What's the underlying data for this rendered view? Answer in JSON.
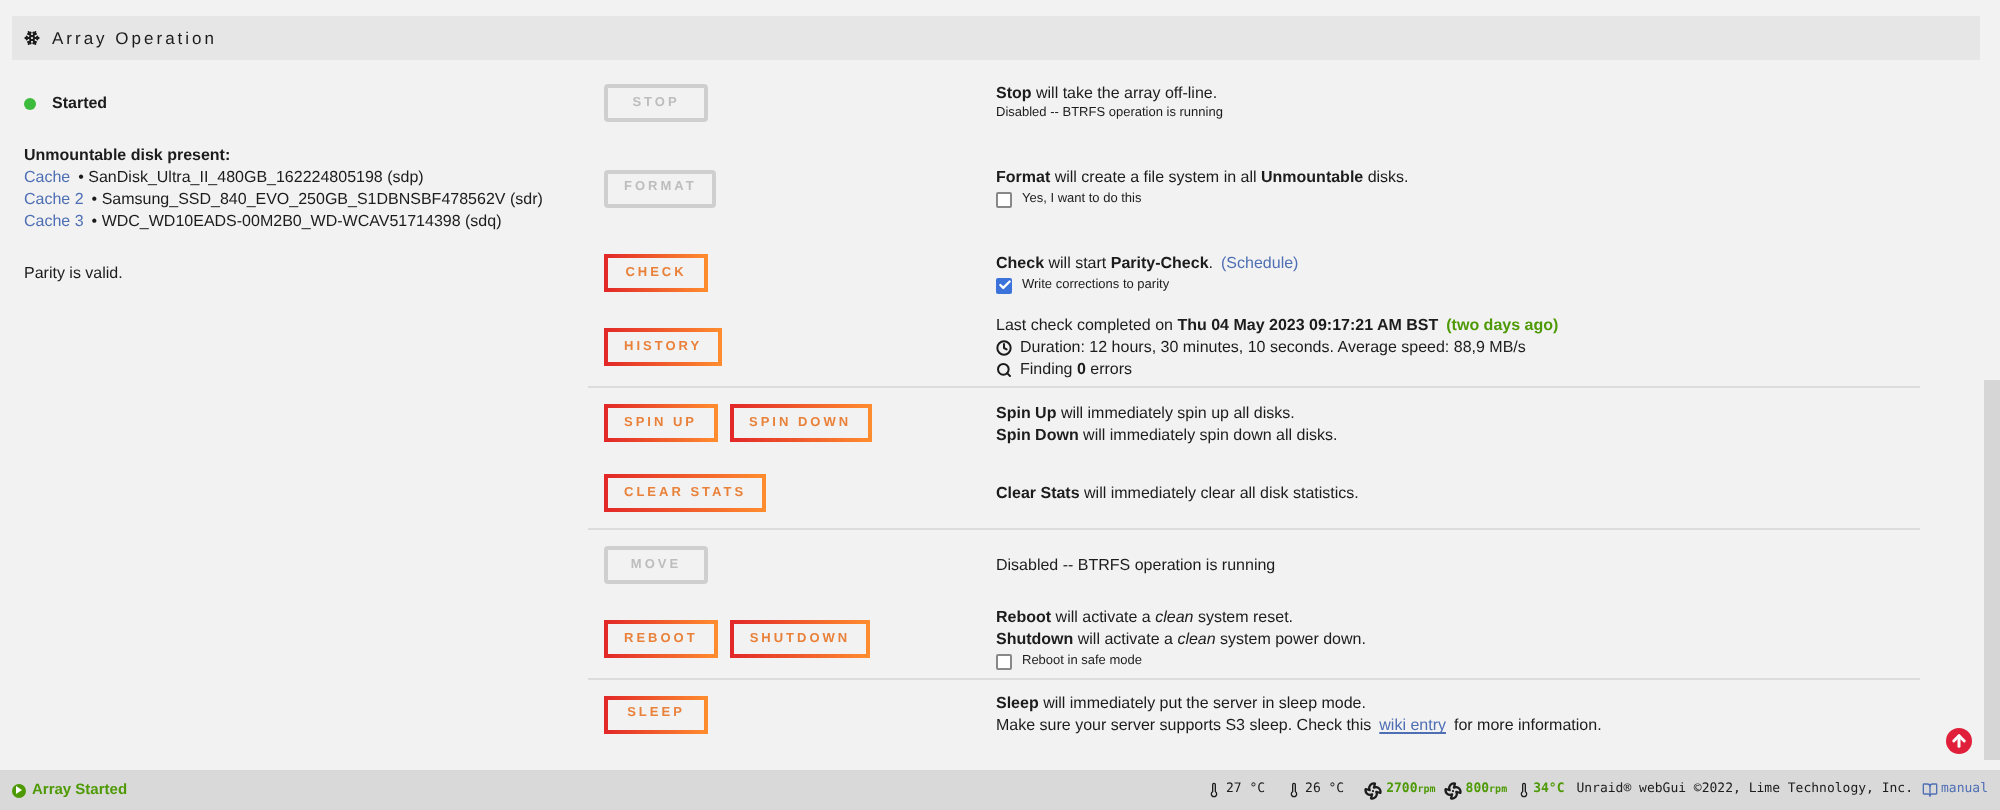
{
  "panel": {
    "title": "Array Operation"
  },
  "sections": [
    {
      "rows": [
        {
          "left": {
            "kind": "status",
            "label": "Started"
          },
          "buttons": [
            {
              "label": "STOP",
              "disabled": true
            }
          ],
          "lines": [
            {
              "kind": "text",
              "text": "**Stop** will take the array off-line."
            },
            {
              "kind": "note",
              "text": "Disabled -- BTRFS operation is running"
            }
          ]
        },
        {
          "left": {
            "kind": "disks",
            "heading": "Unmountable disk present:",
            "disks": [
              {
                "link": "Cache",
                "text": "• SanDisk_Ultra_II_480GB_162224805198 (sdp)"
              },
              {
                "link": "Cache 2",
                "text": "• Samsung_SSD_840_EVO_250GB_S1DBNSBF478562V (sdr)"
              },
              {
                "link": "Cache 3",
                "text": "• WDC_WD10EADS-00M2B0_WD-WCAV51714398 (sdq)"
              }
            ]
          },
          "buttons": [
            {
              "label": "FORMAT",
              "disabled": true
            }
          ],
          "lines": [
            {
              "kind": "text",
              "text": "**Format** will create a file system in all **Unmountable** disks."
            },
            {
              "kind": "checkbox",
              "text": "Yes, I want to do this",
              "checked": false
            }
          ]
        },
        {
          "left": {
            "kind": "text",
            "label": "Parity is valid."
          },
          "buttons": [
            {
              "label": "CHECK",
              "disabled": false
            }
          ],
          "lines": [
            {
              "kind": "text",
              "text": "**Check** will start **Parity-Check**.",
              "link": "(Schedule)"
            },
            {
              "kind": "checkbox",
              "text": "Write corrections to parity",
              "checked": true
            }
          ]
        },
        {
          "buttons": [
            {
              "label": "HISTORY",
              "disabled": false
            }
          ],
          "lines": [
            {
              "kind": "text",
              "text": "Last check completed on **Thu 04 May 2023 09:17:21 AM BST**",
              "highlight": "(two days ago)"
            },
            {
              "kind": "duration",
              "text": "Duration: 12 hours, 30 minutes, 10 seconds. Average speed: 88,9 MB/s"
            },
            {
              "kind": "findings",
              "text": "Finding **0** errors"
            }
          ]
        }
      ]
    },
    {
      "rows": [
        {
          "buttons": [
            {
              "label": "SPIN UP",
              "disabled": false
            },
            {
              "label": "SPIN DOWN",
              "disabled": false
            }
          ],
          "lines": [
            {
              "kind": "text",
              "text": "**Spin Up** will immediately spin up all disks."
            },
            {
              "kind": "text",
              "text": "**Spin Down** will immediately spin down all disks."
            }
          ]
        },
        {
          "buttons": [
            {
              "label": "CLEAR STATS",
              "disabled": false
            }
          ],
          "lines": [
            {
              "kind": "text",
              "text": "**Clear Stats** will immediately clear all disk statistics."
            }
          ]
        }
      ]
    },
    {
      "rows": [
        {
          "buttons": [
            {
              "label": "MOVE",
              "disabled": true
            }
          ],
          "lines": [
            {
              "kind": "text",
              "text": "Disabled -- BTRFS operation is running"
            }
          ]
        },
        {
          "buttons": [
            {
              "label": "REBOOT",
              "disabled": false
            },
            {
              "label": "SHUTDOWN",
              "disabled": false
            }
          ],
          "lines": [
            {
              "kind": "text",
              "text": "**Reboot** will activate a *clean* system reset."
            },
            {
              "kind": "text",
              "text": "**Shutdown** will activate a *clean* system power down."
            },
            {
              "kind": "checkbox",
              "text": "Reboot in safe mode",
              "checked": false
            }
          ]
        }
      ]
    },
    {
      "rows": [
        {
          "buttons": [
            {
              "label": "SLEEP",
              "disabled": false
            }
          ],
          "lines": [
            {
              "kind": "text",
              "text": "**Sleep** will immediately put the server in sleep mode."
            },
            {
              "kind": "text",
              "text": "Make sure your server supports S3 sleep. Check this",
              "link": "wiki entry",
              "after": "for more information."
            }
          ]
        }
      ]
    }
  ],
  "status_bar": {
    "array_state": "Array Started",
    "temps": [
      "27 °C",
      "26 °C"
    ],
    "fans": [
      {
        "speed": "2700",
        "unit": "rpm"
      },
      {
        "speed": "800",
        "unit": "rpm"
      }
    ],
    "cpu_temp": "34°C",
    "copyright": "Unraid® webGui ©2022, Lime Technology, Inc.",
    "manual": "manual"
  }
}
